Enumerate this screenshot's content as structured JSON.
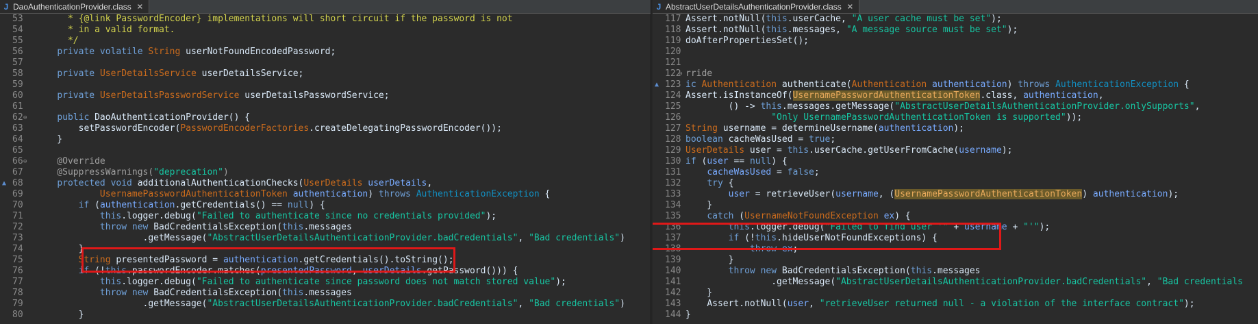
{
  "left": {
    "tab_label": "DaoAuthenticationProvider.class",
    "tab_icon": "java-class-icon",
    "lines": [
      {
        "num": "53",
        "tokens": [
          [
            "      ",
            "p"
          ],
          [
            "* {@link PasswordEncoder} implementations will short circuit if the password is not",
            "cm"
          ]
        ]
      },
      {
        "num": "54",
        "tokens": [
          [
            "      ",
            "p"
          ],
          [
            "* in a valid format.",
            "cm"
          ]
        ]
      },
      {
        "num": "55",
        "tokens": [
          [
            "      ",
            "p"
          ],
          [
            "*/",
            "cm"
          ]
        ]
      },
      {
        "num": "56",
        "tokens": [
          [
            "    ",
            "p"
          ],
          [
            "private volatile ",
            "kw2"
          ],
          [
            "String",
            "kw"
          ],
          [
            " userNotFoundEncodedPassword;",
            "p"
          ]
        ]
      },
      {
        "num": "57",
        "tokens": []
      },
      {
        "num": "58",
        "tokens": [
          [
            "    ",
            "p"
          ],
          [
            "private ",
            "kw2"
          ],
          [
            "UserDetailsService",
            "kw"
          ],
          [
            " userDetailsService;",
            "p"
          ]
        ]
      },
      {
        "num": "59",
        "tokens": []
      },
      {
        "num": "60",
        "tokens": [
          [
            "    ",
            "p"
          ],
          [
            "private ",
            "kw2"
          ],
          [
            "UserDetailsPasswordService",
            "kw"
          ],
          [
            " userDetailsPasswordService;",
            "p"
          ]
        ]
      },
      {
        "num": "61",
        "tokens": []
      },
      {
        "num": "62",
        "fold": true,
        "tokens": [
          [
            "    ",
            "p"
          ],
          [
            "public ",
            "kw2"
          ],
          [
            "DaoAuthenticationProvider() {",
            "p"
          ]
        ]
      },
      {
        "num": "63",
        "tokens": [
          [
            "        setPasswordEncoder(",
            "p"
          ],
          [
            "PasswordEncoderFactories",
            "kw"
          ],
          [
            ".createDelegatingPasswordEncoder());",
            "p"
          ]
        ]
      },
      {
        "num": "64",
        "tokens": [
          [
            "    }",
            "p"
          ]
        ]
      },
      {
        "num": "65",
        "tokens": []
      },
      {
        "num": "66",
        "fold": true,
        "tokens": [
          [
            "    @Override",
            "ann"
          ]
        ]
      },
      {
        "num": "67",
        "tokens": [
          [
            "    @SuppressWarnings(",
            "ann"
          ],
          [
            "\"deprecation\"",
            "str"
          ],
          [
            ")",
            "ann"
          ]
        ]
      },
      {
        "num": "68",
        "ovr": true,
        "tokens": [
          [
            "    ",
            "p"
          ],
          [
            "protected void ",
            "kw2"
          ],
          [
            "additionalAuthenticationChecks(",
            "p"
          ],
          [
            "UserDetails",
            "kw"
          ],
          [
            " ",
            "p"
          ],
          [
            "userDetails",
            "par"
          ],
          [
            ",",
            "p"
          ]
        ]
      },
      {
        "num": "69",
        "tokens": [
          [
            "            ",
            "p"
          ],
          [
            "UsernamePasswordAuthenticationToken",
            "kw"
          ],
          [
            " ",
            "p"
          ],
          [
            "authentication",
            "par"
          ],
          [
            ") ",
            "p"
          ],
          [
            "throws ",
            "kw2"
          ],
          [
            "AuthenticationException",
            "ty"
          ],
          [
            " {",
            "p"
          ]
        ]
      },
      {
        "num": "70",
        "tokens": [
          [
            "        ",
            "p"
          ],
          [
            "if ",
            "kw2"
          ],
          [
            "(",
            "p"
          ],
          [
            "authentication",
            "par"
          ],
          [
            ".getCredentials() == ",
            "p"
          ],
          [
            "null",
            "kw2"
          ],
          [
            ") {",
            "p"
          ]
        ]
      },
      {
        "num": "71",
        "tokens": [
          [
            "            ",
            "p"
          ],
          [
            "this",
            "kw2"
          ],
          [
            ".logger.debug(",
            "p"
          ],
          [
            "\"Failed to authenticate since no credentials provided\"",
            "str"
          ],
          [
            ");",
            "p"
          ]
        ]
      },
      {
        "num": "72",
        "tokens": [
          [
            "            ",
            "p"
          ],
          [
            "throw new ",
            "kw2"
          ],
          [
            "BadCredentialsException(",
            "p"
          ],
          [
            "this",
            "kw2"
          ],
          [
            ".messages",
            "p"
          ]
        ]
      },
      {
        "num": "73",
        "tokens": [
          [
            "                    .getMessage(",
            "p"
          ],
          [
            "\"AbstractUserDetailsAuthenticationProvider.badCredentials\"",
            "str"
          ],
          [
            ", ",
            "p"
          ],
          [
            "\"Bad credentials\"",
            "str"
          ],
          [
            ")",
            "p"
          ]
        ]
      },
      {
        "num": "74",
        "tokens": [
          [
            "        }",
            "p"
          ]
        ]
      },
      {
        "num": "75",
        "tokens": [
          [
            "        ",
            "p"
          ],
          [
            "String",
            "kw"
          ],
          [
            " presentedPassword = ",
            "p"
          ],
          [
            "authentication",
            "par"
          ],
          [
            ".getCredentials().toString();",
            "p"
          ]
        ]
      },
      {
        "num": "76",
        "tokens": [
          [
            "        ",
            "p"
          ],
          [
            "if ",
            "kw2"
          ],
          [
            "(!",
            "p"
          ],
          [
            "this",
            "kw2"
          ],
          [
            ".passwordEncoder.matches(",
            "p"
          ],
          [
            "presentedPassword",
            "par"
          ],
          [
            ", ",
            "p"
          ],
          [
            "userDetails",
            "par"
          ],
          [
            ".getPassword())) {",
            "p"
          ]
        ]
      },
      {
        "num": "77",
        "tokens": [
          [
            "            ",
            "p"
          ],
          [
            "this",
            "kw2"
          ],
          [
            ".logger.debug(",
            "p"
          ],
          [
            "\"Failed to authenticate since password does not match stored value\"",
            "str"
          ],
          [
            ");",
            "p"
          ]
        ]
      },
      {
        "num": "78",
        "tokens": [
          [
            "            ",
            "p"
          ],
          [
            "throw new ",
            "kw2"
          ],
          [
            "BadCredentialsException(",
            "p"
          ],
          [
            "this",
            "kw2"
          ],
          [
            ".messages",
            "p"
          ]
        ]
      },
      {
        "num": "79",
        "tokens": [
          [
            "                    .getMessage(",
            "p"
          ],
          [
            "\"AbstractUserDetailsAuthenticationProvider.badCredentials\"",
            "str"
          ],
          [
            ", ",
            "p"
          ],
          [
            "\"Bad credentials\"",
            "str"
          ],
          [
            ")",
            "p"
          ]
        ]
      },
      {
        "num": "80",
        "tokens": [
          [
            "        }",
            "p"
          ]
        ]
      }
    ]
  },
  "right": {
    "tab_label": "AbstractUserDetailsAuthenticationProvider.class",
    "tab_icon": "java-class-icon",
    "lines": [
      {
        "num": "117",
        "tokens": [
          [
            "Assert.notNull(",
            "p"
          ],
          [
            "this",
            "kw2"
          ],
          [
            ".userCache, ",
            "p"
          ],
          [
            "\"A user cache must be set\"",
            "str"
          ],
          [
            ");",
            "p"
          ]
        ]
      },
      {
        "num": "118",
        "tokens": [
          [
            "Assert.notNull(",
            "p"
          ],
          [
            "this",
            "kw2"
          ],
          [
            ".messages, ",
            "p"
          ],
          [
            "\"A message source must be set\"",
            "str"
          ],
          [
            ");",
            "p"
          ]
        ]
      },
      {
        "num": "119",
        "tokens": [
          [
            "doAfterPropertiesSet();",
            "p"
          ]
        ]
      },
      {
        "num": "120",
        "tokens": []
      },
      {
        "num": "121",
        "tokens": []
      },
      {
        "num": "122",
        "fold": true,
        "tokens": [
          [
            "rride",
            "ann"
          ]
        ]
      },
      {
        "num": "123",
        "ovr": true,
        "tokens": [
          [
            "ic ",
            "kw2"
          ],
          [
            "Authentication",
            "kw"
          ],
          [
            " authenticate(",
            "p"
          ],
          [
            "Authentication",
            "kw"
          ],
          [
            " ",
            "p"
          ],
          [
            "authentication",
            "par"
          ],
          [
            ") ",
            "p"
          ],
          [
            "throws ",
            "kw2"
          ],
          [
            "AuthenticationException",
            "ty"
          ],
          [
            " {",
            "p"
          ]
        ]
      },
      {
        "num": "124",
        "tokens": [
          [
            "Assert.isInstanceOf(",
            "p"
          ],
          [
            "UsernamePasswordAuthenticationToken",
            "hl"
          ],
          [
            ".class, ",
            "p"
          ],
          [
            "authentication",
            "par"
          ],
          [
            ",",
            "p"
          ]
        ]
      },
      {
        "num": "125",
        "tokens": [
          [
            "        () -> ",
            "p"
          ],
          [
            "this",
            "kw2"
          ],
          [
            ".messages.getMessage(",
            "p"
          ],
          [
            "\"AbstractUserDetailsAuthenticationProvider.onlySupports\"",
            "str"
          ],
          [
            ",",
            "p"
          ]
        ]
      },
      {
        "num": "126",
        "tokens": [
          [
            "                ",
            "p"
          ],
          [
            "\"Only UsernamePasswordAuthenticationToken is supported\"",
            "str"
          ],
          [
            "));",
            "p"
          ]
        ]
      },
      {
        "num": "127",
        "tokens": [
          [
            "String",
            "kw"
          ],
          [
            " username = determineUsername(",
            "p"
          ],
          [
            "authentication",
            "par"
          ],
          [
            ");",
            "p"
          ]
        ]
      },
      {
        "num": "128",
        "tokens": [
          [
            "boolean ",
            "kw2"
          ],
          [
            "cacheWasUsed = ",
            "p"
          ],
          [
            "true",
            "kw2"
          ],
          [
            ";",
            "p"
          ]
        ]
      },
      {
        "num": "129",
        "tokens": [
          [
            "UserDetails",
            "kw"
          ],
          [
            " user = ",
            "p"
          ],
          [
            "this",
            "kw2"
          ],
          [
            ".userCache.getUserFromCache(",
            "p"
          ],
          [
            "username",
            "par"
          ],
          [
            ");",
            "p"
          ]
        ]
      },
      {
        "num": "130",
        "tokens": [
          [
            "if ",
            "kw2"
          ],
          [
            "(",
            "p"
          ],
          [
            "user",
            "par"
          ],
          [
            " == ",
            "p"
          ],
          [
            "null",
            "kw2"
          ],
          [
            ") {",
            "p"
          ]
        ]
      },
      {
        "num": "131",
        "tokens": [
          [
            "    ",
            "p"
          ],
          [
            "cacheWasUsed",
            "par"
          ],
          [
            " = ",
            "p"
          ],
          [
            "false",
            "kw2"
          ],
          [
            ";",
            "p"
          ]
        ]
      },
      {
        "num": "132",
        "tokens": [
          [
            "    ",
            "p"
          ],
          [
            "try ",
            "kw2"
          ],
          [
            "{",
            "p"
          ]
        ]
      },
      {
        "num": "133",
        "tokens": [
          [
            "        ",
            "p"
          ],
          [
            "user",
            "par"
          ],
          [
            " = retrieveUser(",
            "p"
          ],
          [
            "username",
            "par"
          ],
          [
            ", (",
            "p"
          ],
          [
            "UsernamePasswordAuthenticationToken",
            "hl"
          ],
          [
            ") ",
            "p"
          ],
          [
            "authentication",
            "par"
          ],
          [
            ");",
            "p"
          ]
        ]
      },
      {
        "num": "134",
        "tokens": [
          [
            "    }",
            "p"
          ]
        ]
      },
      {
        "num": "135",
        "tokens": [
          [
            "    ",
            "p"
          ],
          [
            "catch ",
            "kw2"
          ],
          [
            "(",
            "p"
          ],
          [
            "UsernameNotFoundException",
            "kw"
          ],
          [
            " ",
            "p"
          ],
          [
            "ex",
            "par"
          ],
          [
            ") {",
            "p"
          ]
        ]
      },
      {
        "num": "136",
        "tokens": [
          [
            "        ",
            "p"
          ],
          [
            "this",
            "kw2"
          ],
          [
            ".logger.debug(",
            "p"
          ],
          [
            "\"Failed to find user '\"",
            "str"
          ],
          [
            " + ",
            "p"
          ],
          [
            "username",
            "par"
          ],
          [
            " + ",
            "p"
          ],
          [
            "\"'\"",
            "str"
          ],
          [
            ");",
            "p"
          ]
        ]
      },
      {
        "num": "137",
        "tokens": [
          [
            "        ",
            "p"
          ],
          [
            "if ",
            "kw2"
          ],
          [
            "(!",
            "p"
          ],
          [
            "this",
            "kw2"
          ],
          [
            ".hideUserNotFoundExceptions) {",
            "p"
          ]
        ]
      },
      {
        "num": "138",
        "tokens": [
          [
            "            ",
            "p"
          ],
          [
            "throw ",
            "kw2"
          ],
          [
            "ex",
            "par"
          ],
          [
            ";",
            "p"
          ]
        ]
      },
      {
        "num": "139",
        "tokens": [
          [
            "        }",
            "p"
          ]
        ]
      },
      {
        "num": "140",
        "tokens": [
          [
            "        ",
            "p"
          ],
          [
            "throw new ",
            "kw2"
          ],
          [
            "BadCredentialsException(",
            "p"
          ],
          [
            "this",
            "kw2"
          ],
          [
            ".messages",
            "p"
          ]
        ]
      },
      {
        "num": "141",
        "tokens": [
          [
            "                .getMessage(",
            "p"
          ],
          [
            "\"AbstractUserDetailsAuthenticationProvider.badCredentials\"",
            "str"
          ],
          [
            ", ",
            "p"
          ],
          [
            "\"Bad credentials",
            "str"
          ]
        ]
      },
      {
        "num": "142",
        "tokens": [
          [
            "    }",
            "p"
          ]
        ]
      },
      {
        "num": "143",
        "tokens": [
          [
            "    ",
            "p"
          ],
          [
            "Assert.notNull(",
            "p"
          ],
          [
            "user",
            "par"
          ],
          [
            ", ",
            "p"
          ],
          [
            "\"retrieveUser returned null - a violation of the interface contract\"",
            "str"
          ],
          [
            ");",
            "p"
          ]
        ]
      },
      {
        "num": "144",
        "tokens": [
          [
            "}",
            "p"
          ]
        ]
      }
    ]
  },
  "colors": {
    "highlight_box": "#e01818",
    "editor_bg": "#2b2b2b"
  }
}
